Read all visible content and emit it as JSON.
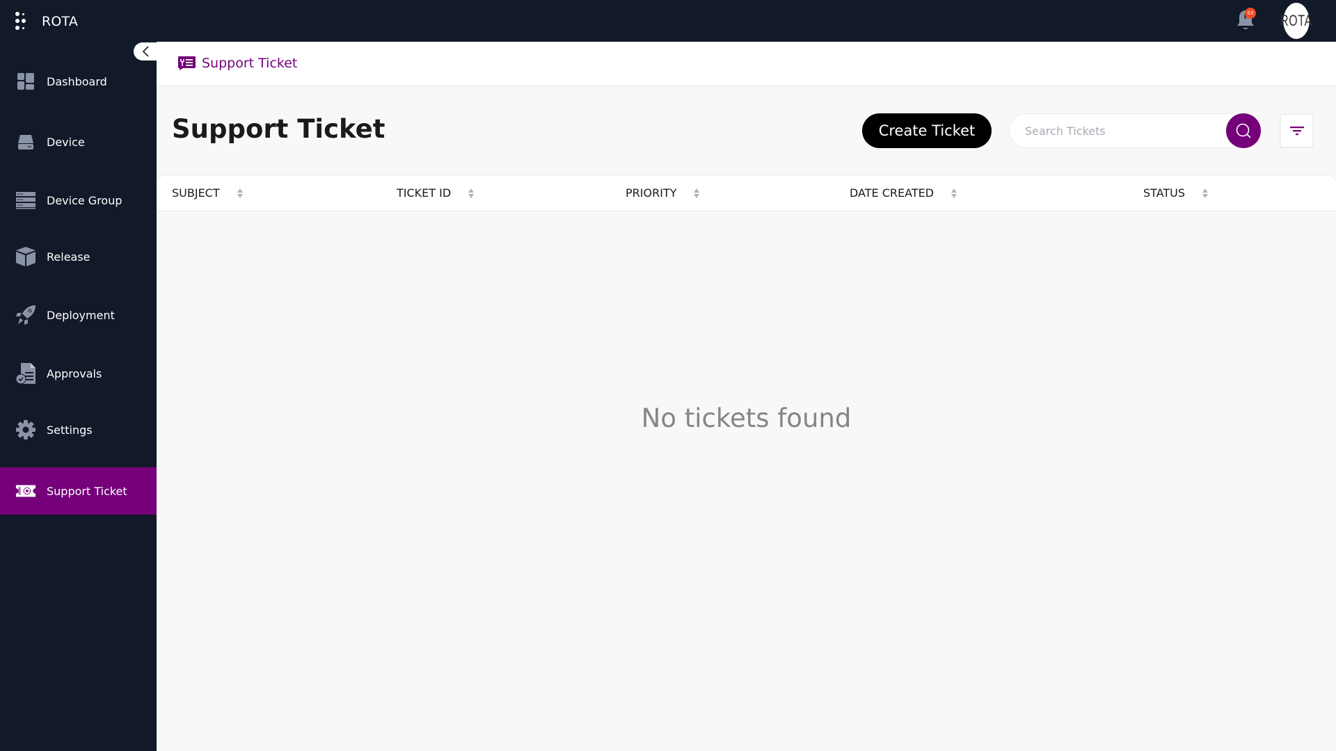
{
  "app": {
    "name": "ROTA",
    "notifications_count": "03",
    "avatar_text": "ROTA"
  },
  "colors": {
    "topbar_bg": "#121929",
    "sidebar_bg": "#121929",
    "accent": "#75007a",
    "badge": "#f04a24",
    "primary_button": "#000000"
  },
  "sidebar": {
    "items": [
      {
        "label": "Dashboard",
        "icon": "dashboard-icon",
        "active": false
      },
      {
        "label": "Device",
        "icon": "device-icon",
        "active": false
      },
      {
        "label": "Device Group",
        "icon": "device-group-icon",
        "active": false
      },
      {
        "label": "Release",
        "icon": "box-icon",
        "active": false
      },
      {
        "label": "Deployment",
        "icon": "rocket-icon",
        "active": false
      },
      {
        "label": "Approvals",
        "icon": "approvals-icon",
        "active": false
      },
      {
        "label": "Settings",
        "icon": "gear-icon",
        "active": false
      },
      {
        "label": "Support Ticket",
        "icon": "ticket-icon",
        "active": true
      }
    ]
  },
  "breadcrumb": {
    "label": "Support Ticket",
    "icon": "support-ticket-icon"
  },
  "page": {
    "title": "Support Ticket",
    "create_button": "Create Ticket",
    "search": {
      "placeholder": "Search Tickets",
      "value": ""
    },
    "filter_icon": "filter-icon"
  },
  "table": {
    "columns": [
      {
        "label": "SUBJECT"
      },
      {
        "label": "TICKET ID"
      },
      {
        "label": "PRIORITY"
      },
      {
        "label": "DATE CREATED"
      },
      {
        "label": "STATUS"
      }
    ],
    "rows": [],
    "empty_message": "No tickets found"
  }
}
